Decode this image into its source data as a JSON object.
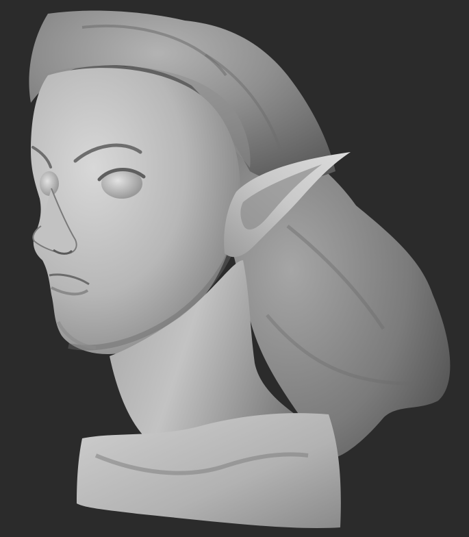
{
  "scene": {
    "subject": "sculpt-bust",
    "colors": {
      "background": "#2b2b2b",
      "clay_light": "#d6d6d6",
      "clay_mid": "#a9a9a9",
      "clay_dark": "#6f6f6f",
      "clay_shadow": "#3f3f3f"
    }
  }
}
